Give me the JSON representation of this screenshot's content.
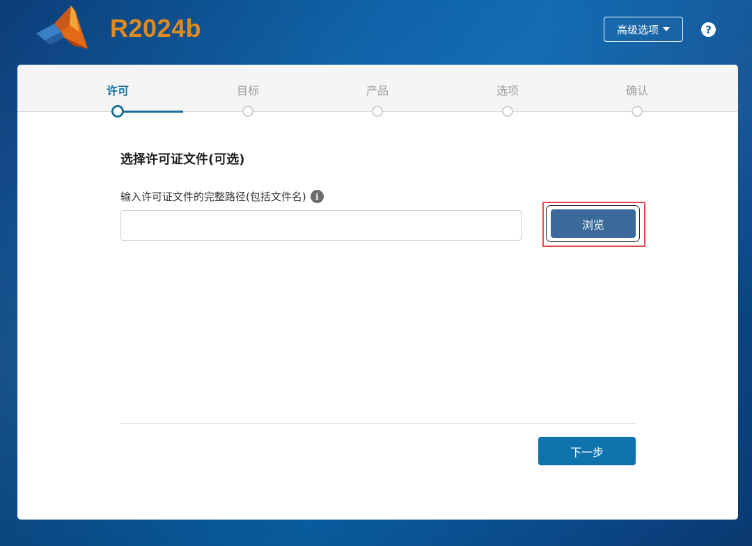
{
  "header": {
    "version": "R2024b",
    "advanced_options_label": "高级选项",
    "help_label": "?"
  },
  "steps": [
    {
      "label": "许可",
      "active": true
    },
    {
      "label": "目标",
      "active": false
    },
    {
      "label": "产品",
      "active": false
    },
    {
      "label": "选项",
      "active": false
    },
    {
      "label": "确认",
      "active": false
    }
  ],
  "main": {
    "section_title": "选择许可证文件(可选)",
    "field_label": "输入许可证文件的完整路径(包括文件名)",
    "info_icon": "i",
    "input_value": "",
    "browse_label": "浏览",
    "next_label": "下一步"
  },
  "colors": {
    "accent": "#1a6f9e",
    "browse_button": "#3a6a99",
    "next_button": "#0f74ad",
    "version_text": "#e08a1e",
    "highlight": "#e8484f"
  },
  "icons": [
    "matlab-logo-icon",
    "caret-down-icon",
    "help-icon",
    "info-icon"
  ]
}
